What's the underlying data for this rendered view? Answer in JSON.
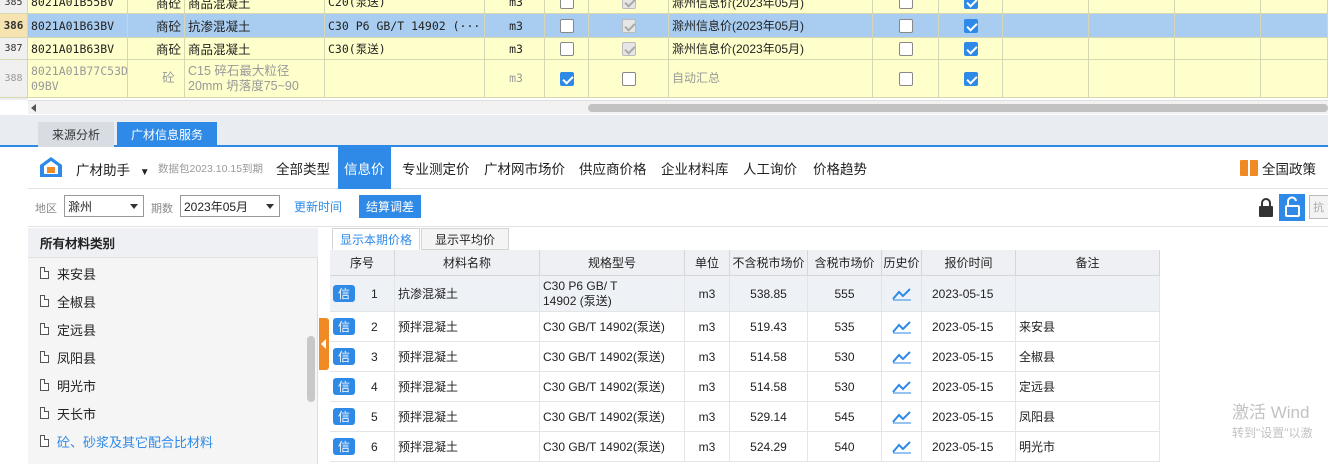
{
  "upper_rows": [
    {
      "num": "385",
      "code": "8021A01B55BV",
      "type": "商砼",
      "name": "商品混凝土",
      "spec": "C20(泵送)",
      "unit": "m3",
      "cb1": false,
      "cb2": "gray",
      "src": "滁州信息价(2023年05月)",
      "cb3": false,
      "cb4": true,
      "selected": false,
      "partial": true
    },
    {
      "num": "386",
      "code": "8021A01B63BV",
      "type": "商砼",
      "name": "抗渗混凝土",
      "spec": "C30 P6  GB/T 14902 (···",
      "unit": "m3",
      "cb1": false,
      "cb2": "gray",
      "src": "滁州信息价(2023年05月)",
      "cb3": false,
      "cb4": true,
      "selected": true
    },
    {
      "num": "387",
      "code": "8021A01B63BV",
      "type": "商砼",
      "name": "商品混凝土",
      "spec": "C30(泵送)",
      "unit": "m3",
      "cb1": false,
      "cb2": "gray",
      "src": "滁州信息价(2023年05月)",
      "cb3": false,
      "cb4": true,
      "selected": false
    },
    {
      "num": "388",
      "code": "8021A01B77C53D 09BV",
      "type": "砼",
      "name": "C15 碎石最大粒径20mm 坍落度75~90",
      "spec": "",
      "unit": "m3",
      "cb1": true,
      "cb2": "off",
      "src": "自动汇总",
      "cb3": false,
      "cb4": true,
      "selected": false,
      "gray": true
    }
  ],
  "tabs": {
    "source_analysis": "来源分析",
    "guangcai_service": "广材信息服务"
  },
  "toolbar": {
    "assistant": "广材助手",
    "data_pack": "数据包2023.10.15到期",
    "nav": [
      "全部类型",
      "信息价",
      "专业测定价",
      "广材网市场价",
      "供应商价格",
      "企业材料库",
      "人工询价",
      "价格趋势"
    ],
    "active_nav": 1,
    "policy": "全国政策"
  },
  "filter": {
    "region_label": "地区",
    "region": "滁州",
    "period_label": "期数",
    "period": "2023年05月",
    "update_time": "更新时间",
    "settle": "结算调差",
    "truncated": "抗"
  },
  "left": {
    "header": "所有材料类别",
    "items": [
      "来安县",
      "全椒县",
      "定远县",
      "凤阳县",
      "明光市",
      "天长市",
      "砼、砂浆及其它配合比材料"
    ]
  },
  "subtabs": {
    "current": "显示本期价格",
    "average": "显示平均价"
  },
  "table": {
    "headers": [
      "序号",
      "材料名称",
      "规格型号",
      "单位",
      "不含税市场价",
      "含税市场价",
      "历史价",
      "报价时间",
      "备注"
    ],
    "badge": "信",
    "rows": [
      {
        "no": "1",
        "name": "抗渗混凝土",
        "spec": "C30  P6  GB/ T 14902 (泵送)",
        "unit": "m3",
        "pre": "538.85",
        "tax": "555",
        "date": "2023-05-15",
        "note": ""
      },
      {
        "no": "2",
        "name": "预拌混凝土",
        "spec": "C30 GB/T 14902(泵送)",
        "unit": "m3",
        "pre": "519.43",
        "tax": "535",
        "date": "2023-05-15",
        "note": "来安县"
      },
      {
        "no": "3",
        "name": "预拌混凝土",
        "spec": "C30 GB/T 14902(泵送)",
        "unit": "m3",
        "pre": "514.58",
        "tax": "530",
        "date": "2023-05-15",
        "note": "全椒县"
      },
      {
        "no": "4",
        "name": "预拌混凝土",
        "spec": "C30 GB/T 14902(泵送)",
        "unit": "m3",
        "pre": "514.58",
        "tax": "530",
        "date": "2023-05-15",
        "note": "定远县"
      },
      {
        "no": "5",
        "name": "预拌混凝土",
        "spec": "C30 GB/T 14902(泵送)",
        "unit": "m3",
        "pre": "529.14",
        "tax": "545",
        "date": "2023-05-15",
        "note": "凤阳县"
      },
      {
        "no": "6",
        "name": "预拌混凝土",
        "spec": "C30 GB/T 14902(泵送)",
        "unit": "m3",
        "pre": "524.29",
        "tax": "540",
        "date": "2023-05-15",
        "note": "明光市"
      }
    ]
  },
  "watermark": {
    "line1": "激活 Wind",
    "line2": "转到\"设置\"以激"
  },
  "colors": {
    "accent": "#2e8ae6",
    "row_yellow": "#ffffcc",
    "selected_row": "#a8cdf0",
    "orange": "#f08a24"
  }
}
